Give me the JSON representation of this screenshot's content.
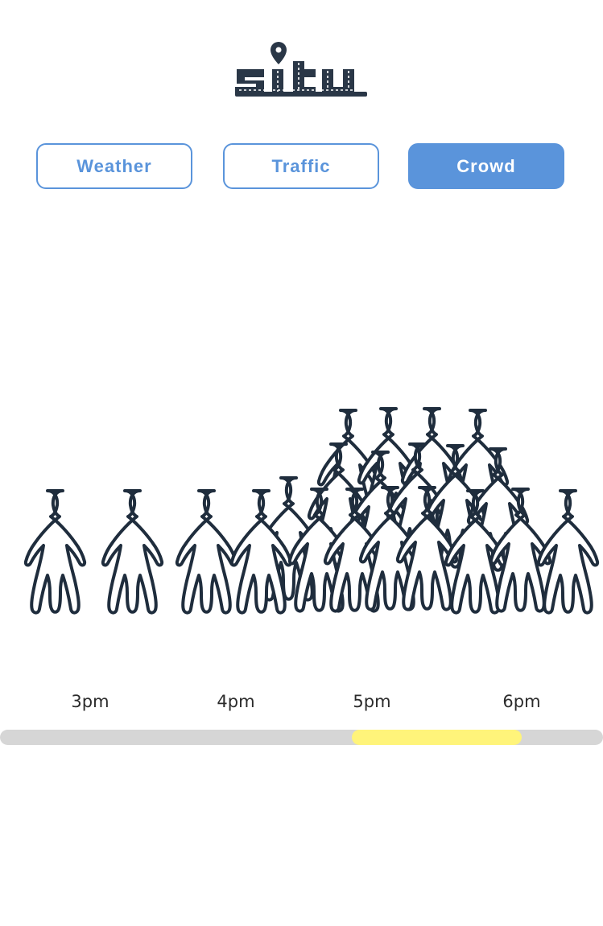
{
  "app": {
    "logo_text": "situ"
  },
  "tabs": [
    {
      "label": "Weather",
      "active": false
    },
    {
      "label": "Traffic",
      "active": false
    },
    {
      "label": "Crowd",
      "active": true
    }
  ],
  "colors": {
    "accent": "#5a94db",
    "ink": "#1f2d3d",
    "track": "#d6d6d6",
    "highlight": "#fff47a"
  },
  "crowd_view": {
    "icon": "crowd-silhouettes"
  },
  "timeline": {
    "labels": [
      "3pm",
      "4pm",
      "5pm",
      "6pm"
    ],
    "selection_start": 0.583,
    "selection_end": 0.865
  }
}
